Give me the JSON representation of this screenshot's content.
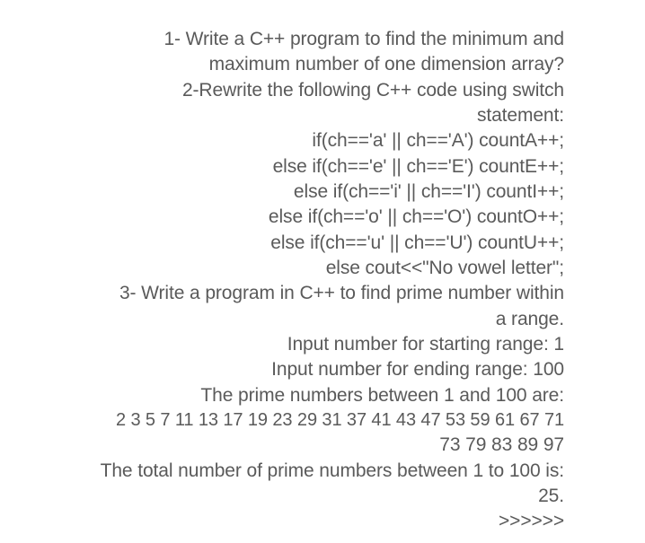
{
  "q1": {
    "line1": "1-  Write a C++ program to find the minimum and",
    "line2": "maximum number of one dimension array?"
  },
  "q2": {
    "line1": "2-Rewrite the following C++ code using switch",
    "line2": "statement:",
    "code": {
      "l1": "if(ch=='a' || ch=='A') countA++;",
      "l2": "else if(ch=='e' || ch=='E') countE++;",
      "l3": "else if(ch=='i' || ch=='I') countI++;",
      "l4": "else if(ch=='o' || ch=='O') countO++;",
      "l5": "else if(ch=='u' || ch=='U') countU++;",
      "l6": "else cout<<\"No vowel letter\";"
    }
  },
  "q3": {
    "line1": "3- Write a program in C++ to find prime number within",
    "line2": "a range.",
    "input1": "Input number for starting range: 1",
    "input2": "Input number for ending range: 100",
    "between": "The prime numbers between 1 and 100 are:",
    "primes1": "2 3 5 7 11 13 17 19 23 29 31 37 41 43 47 53 59 61 67 71",
    "primes2": "73 79 83 89 97",
    "total": "The total number of prime numbers between 1 to 100 is:",
    "count": "25.",
    "arrows": ">>>>>>"
  }
}
